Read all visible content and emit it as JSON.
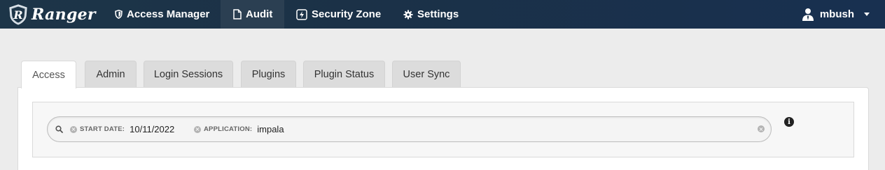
{
  "brand": {
    "name": "Ranger",
    "logo_icon": "ranger-shield-logo"
  },
  "nav": {
    "access_manager": "Access Manager",
    "audit": "Audit",
    "security_zone": "Security Zone",
    "settings": "Settings",
    "active": "Audit"
  },
  "user": {
    "name": "mbush",
    "icon": "user-icon"
  },
  "tabs": [
    {
      "label": "Access",
      "active": true
    },
    {
      "label": "Admin"
    },
    {
      "label": "Login Sessions"
    },
    {
      "label": "Plugins"
    },
    {
      "label": "Plugin Status"
    },
    {
      "label": "User Sync"
    }
  ],
  "search": {
    "facets": [
      {
        "category": "START DATE:",
        "value": "10/11/2022"
      },
      {
        "category": "APPLICATION:",
        "value": "impala"
      }
    ]
  },
  "colors": {
    "navbar": "#1b3147",
    "nav_active": "#2b3f52",
    "page_bg": "#ececec",
    "tab_inactive": "#dcdcdc"
  }
}
